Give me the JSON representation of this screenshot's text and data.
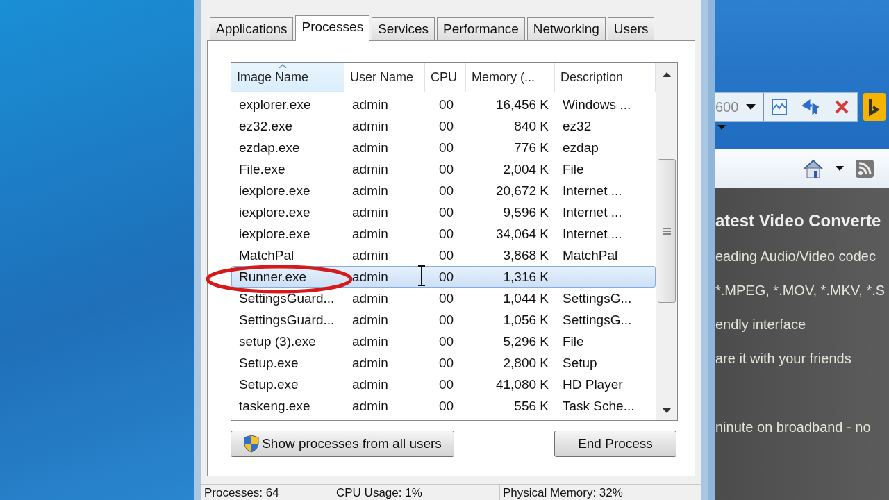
{
  "tabs": [
    {
      "label": "Applications",
      "selected": false
    },
    {
      "label": "Processes",
      "selected": true
    },
    {
      "label": "Services",
      "selected": false
    },
    {
      "label": "Performance",
      "selected": false
    },
    {
      "label": "Networking",
      "selected": false
    },
    {
      "label": "Users",
      "selected": false
    }
  ],
  "table": {
    "columns": [
      {
        "label": "Image Name",
        "sorted": true
      },
      {
        "label": "User Name",
        "sorted": false
      },
      {
        "label": "CPU",
        "sorted": false
      },
      {
        "label": "Memory (...",
        "sorted": false
      },
      {
        "label": "Description",
        "sorted": false
      }
    ],
    "rows": [
      {
        "cells": [
          "explorer.exe",
          "admin",
          "00",
          "16,456 K",
          "Windows ..."
        ],
        "selected": false
      },
      {
        "cells": [
          "ez32.exe",
          "admin",
          "00",
          "840 K",
          "ez32"
        ],
        "selected": false
      },
      {
        "cells": [
          "ezdap.exe",
          "admin",
          "00",
          "776 K",
          "ezdap"
        ],
        "selected": false
      },
      {
        "cells": [
          "File.exe",
          "admin",
          "00",
          "2,004 K",
          "File"
        ],
        "selected": false
      },
      {
        "cells": [
          "iexplore.exe",
          "admin",
          "00",
          "20,672 K",
          "Internet ..."
        ],
        "selected": false
      },
      {
        "cells": [
          "iexplore.exe",
          "admin",
          "00",
          "9,596 K",
          "Internet ..."
        ],
        "selected": false
      },
      {
        "cells": [
          "iexplore.exe",
          "admin",
          "00",
          "34,064 K",
          "Internet ..."
        ],
        "selected": false
      },
      {
        "cells": [
          "MatchPal",
          "admin",
          "00",
          "3,868 K",
          "MatchPal"
        ],
        "selected": false
      },
      {
        "cells": [
          "Runner.exe",
          "admin",
          "00",
          "1,316 K",
          ""
        ],
        "selected": true
      },
      {
        "cells": [
          "SettingsGuard...",
          "admin",
          "00",
          "1,044 K",
          "SettingsG..."
        ],
        "selected": false
      },
      {
        "cells": [
          "SettingsGuard...",
          "admin",
          "00",
          "1,056 K",
          "SettingsG..."
        ],
        "selected": false
      },
      {
        "cells": [
          "setup (3).exe",
          "admin",
          "00",
          "5,296 K",
          "File"
        ],
        "selected": false
      },
      {
        "cells": [
          "Setup.exe",
          "admin",
          "00",
          "2,800 K",
          "Setup"
        ],
        "selected": false
      },
      {
        "cells": [
          "Setup.exe",
          "admin",
          "00",
          "41,080 K",
          "HD Player"
        ],
        "selected": false
      },
      {
        "cells": [
          "taskeng.exe",
          "admin",
          "00",
          "556 K",
          "Task Sche..."
        ],
        "selected": false
      }
    ]
  },
  "buttons": [
    {
      "label": "Show processes from all users",
      "kind": "shield"
    },
    {
      "label": "End Process",
      "kind": "plain"
    }
  ],
  "status_bar": [
    "Processes: 64",
    "CPU Usage: 1%",
    "Physical Memory: 32%"
  ],
  "browser": {
    "address": "600",
    "heading": "atest Video Converte",
    "lines": [
      "eading Audio/Video codec",
      "*.MPEG, *.MOV, *.MKV, *.S",
      "endly interface",
      "are it with your friends",
      "ninute on broadband - no"
    ]
  }
}
